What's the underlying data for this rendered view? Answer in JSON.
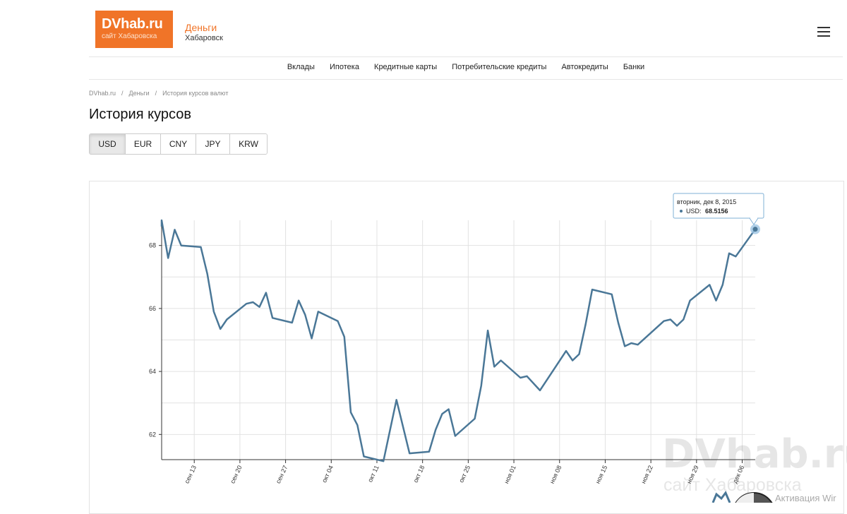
{
  "header": {
    "logo_title": "DVhab.ru",
    "logo_subtitle": "сайт Хабаровска",
    "section_title": "Деньги",
    "section_city": "Хабаровск",
    "accent_color": "#f07428"
  },
  "nav": {
    "items": [
      "Вклады",
      "Ипотека",
      "Кредитные карты",
      "Потребительские кредиты",
      "Автокредиты",
      "Банки"
    ]
  },
  "breadcrumb": [
    "DVhab.ru",
    "Деньги",
    "История курсов валют"
  ],
  "page_title": "История курсов",
  "currency_tabs": [
    "USD",
    "EUR",
    "CNY",
    "JPY",
    "KRW"
  ],
  "active_currency": "USD",
  "tooltip": {
    "date": "вторник, дек 8, 2015",
    "series": "USD:",
    "value": "68.5156"
  },
  "watermark": {
    "title": "DVhab.ru",
    "subtitle": "сайт Хабаровска",
    "windows_text": "Активация Wir"
  },
  "chart_data": {
    "type": "line",
    "title": "",
    "xlabel": "",
    "ylabel": "",
    "x_tick_labels": [
      "сен 13",
      "сен 20",
      "сен 27",
      "окт 04",
      "окт 11",
      "окт 18",
      "окт 25",
      "ноя 01",
      "ноя 08",
      "ноя 15",
      "ноя 22",
      "ноя 29",
      "дек 06"
    ],
    "y_tick_labels": [
      "62",
      "64",
      "66",
      "68"
    ],
    "ylim": [
      61.2,
      68.8
    ],
    "xlim": [
      "2015-09-08",
      "2015-12-08"
    ],
    "grid": true,
    "line_color": "#4a7797",
    "series": [
      {
        "name": "USD",
        "points": [
          [
            "2015-09-08",
            68.6
          ],
          [
            "2015-09-08",
            68.8
          ],
          [
            "2015-09-09",
            67.6
          ],
          [
            "2015-09-10",
            68.5
          ],
          [
            "2015-09-11",
            68.0
          ],
          [
            "2015-09-14",
            67.95
          ],
          [
            "2015-09-15",
            67.1
          ],
          [
            "2015-09-16",
            65.9
          ],
          [
            "2015-09-17",
            65.35
          ],
          [
            "2015-09-18",
            65.65
          ],
          [
            "2015-09-21",
            66.15
          ],
          [
            "2015-09-22",
            66.2
          ],
          [
            "2015-09-23",
            66.05
          ],
          [
            "2015-09-24",
            66.5
          ],
          [
            "2015-09-25",
            65.7
          ],
          [
            "2015-09-28",
            65.55
          ],
          [
            "2015-09-29",
            66.25
          ],
          [
            "2015-09-30",
            65.8
          ],
          [
            "2015-10-01",
            65.05
          ],
          [
            "2015-10-02",
            65.9
          ],
          [
            "2015-10-05",
            65.6
          ],
          [
            "2015-10-06",
            65.1
          ],
          [
            "2015-10-07",
            62.7
          ],
          [
            "2015-10-08",
            62.3
          ],
          [
            "2015-10-09",
            61.3
          ],
          [
            "2015-10-12",
            61.15
          ],
          [
            "2015-10-14",
            63.1
          ],
          [
            "2015-10-16",
            61.4
          ],
          [
            "2015-10-19",
            61.45
          ],
          [
            "2015-10-20",
            62.15
          ],
          [
            "2015-10-21",
            62.65
          ],
          [
            "2015-10-22",
            62.8
          ],
          [
            "2015-10-23",
            61.95
          ],
          [
            "2015-10-26",
            62.5
          ],
          [
            "2015-10-27",
            63.55
          ],
          [
            "2015-10-28",
            65.3
          ],
          [
            "2015-10-29",
            64.15
          ],
          [
            "2015-10-30",
            64.35
          ],
          [
            "2015-11-02",
            63.8
          ],
          [
            "2015-11-03",
            63.85
          ],
          [
            "2015-11-05",
            63.4
          ],
          [
            "2015-11-09",
            64.65
          ],
          [
            "2015-11-10",
            64.35
          ],
          [
            "2015-11-11",
            64.55
          ],
          [
            "2015-11-12",
            65.5
          ],
          [
            "2015-11-13",
            66.6
          ],
          [
            "2015-11-16",
            66.45
          ],
          [
            "2015-11-17",
            65.55
          ],
          [
            "2015-11-18",
            64.8
          ],
          [
            "2015-11-19",
            64.9
          ],
          [
            "2015-11-20",
            64.85
          ],
          [
            "2015-11-24",
            65.6
          ],
          [
            "2015-11-25",
            65.65
          ],
          [
            "2015-11-26",
            65.45
          ],
          [
            "2015-11-27",
            65.65
          ],
          [
            "2015-11-28",
            66.25
          ],
          [
            "2015-12-01",
            66.75
          ],
          [
            "2015-12-02",
            66.25
          ],
          [
            "2015-12-03",
            66.75
          ],
          [
            "2015-12-04",
            67.75
          ],
          [
            "2015-12-05",
            67.65
          ],
          [
            "2015-12-08",
            68.5156
          ]
        ]
      }
    ]
  }
}
